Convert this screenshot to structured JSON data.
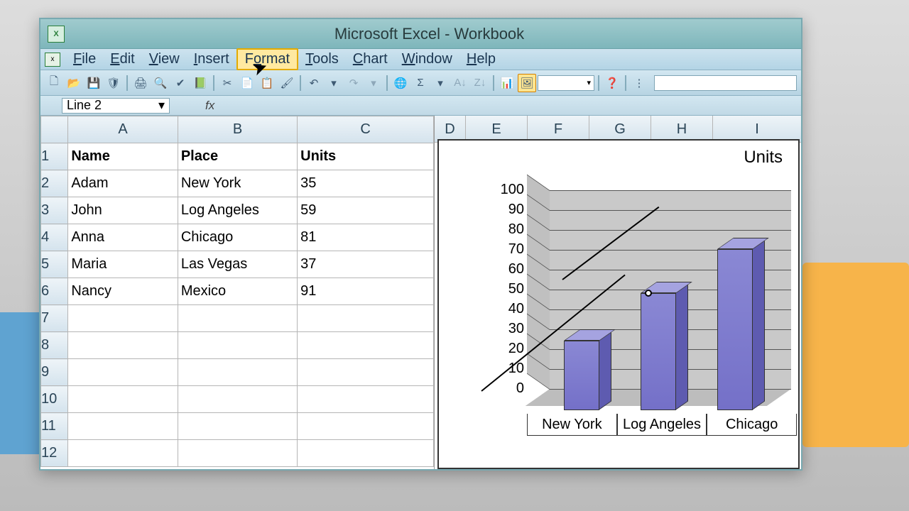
{
  "titlebar": {
    "title": "Microsoft Excel - Workbook"
  },
  "menus": {
    "file": "File",
    "edit": "Edit",
    "view": "View",
    "insert": "Insert",
    "format": "Format",
    "tools": "Tools",
    "chart": "Chart",
    "window": "Window",
    "help": "Help"
  },
  "namebox": {
    "value": "Line 2"
  },
  "columns": {
    "A": "A",
    "B": "B",
    "C": "C",
    "D": "D",
    "E": "E",
    "F": "F",
    "G": "G",
    "H": "H",
    "I": "I"
  },
  "headers": {
    "name": "Name",
    "place": "Place",
    "units": "Units"
  },
  "rows": [
    {
      "name": "Adam",
      "place": "New York",
      "units": "35"
    },
    {
      "name": "John",
      "place": "Log Angeles",
      "units": "59"
    },
    {
      "name": "Anna",
      "place": "Chicago",
      "units": "81"
    },
    {
      "name": "Maria",
      "place": "Las Vegas",
      "units": "37"
    },
    {
      "name": "Nancy",
      "place": "Mexico",
      "units": "91"
    }
  ],
  "chart_data": {
    "type": "bar",
    "title": "Units",
    "categories": [
      "New York",
      "Log Angeles",
      "Chicago"
    ],
    "values": [
      35,
      59,
      81
    ],
    "ylabel": "",
    "xlabel": "",
    "ylim": [
      0,
      100
    ],
    "y_ticks": [
      0,
      10,
      20,
      30,
      40,
      50,
      60,
      70,
      80,
      90,
      100
    ]
  }
}
